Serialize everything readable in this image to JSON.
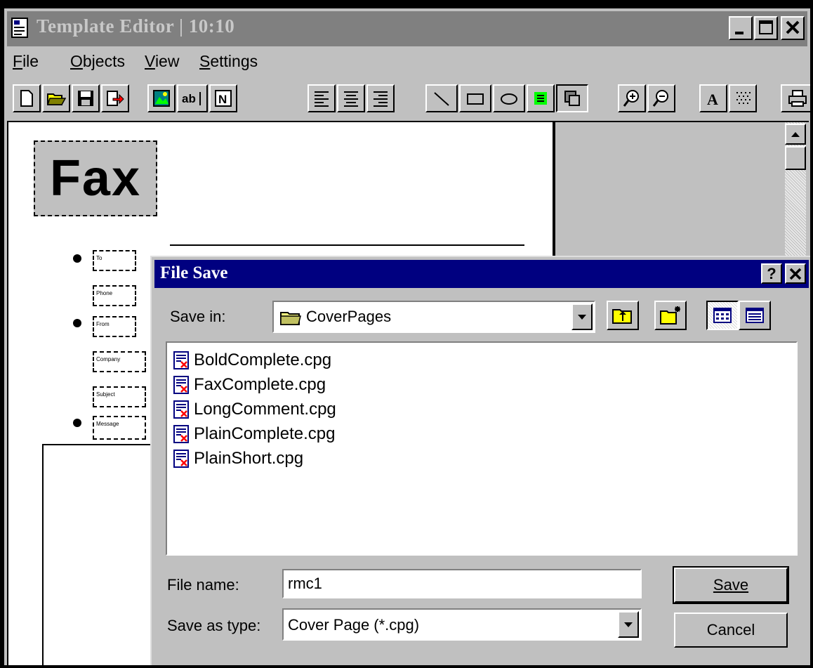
{
  "window": {
    "title": "Template Editor | 10:10",
    "controls": [
      "minimize-icon",
      "maximize-icon",
      "close-icon"
    ]
  },
  "menu": {
    "items": [
      "File",
      "Objects",
      "View",
      "Settings"
    ]
  },
  "toolbar": {
    "icons": [
      "new-document-icon",
      "open-folder-icon",
      "save-disk-icon",
      "export-icon",
      "image-icon",
      "text-field-icon",
      "field-n-icon",
      "align-left-icon",
      "align-center-icon",
      "align-right-icon",
      "line-icon",
      "rectangle-icon",
      "ellipse-icon",
      "fill-color-icon",
      "bring-to-front-icon",
      "zoom-in-icon",
      "zoom-out-icon",
      "font-icon",
      "grid-icon",
      "print-icon"
    ]
  },
  "page": {
    "logo_text": "Fax",
    "fields": [
      "To",
      "Phone",
      "From",
      "Company",
      "Subject",
      "Message"
    ]
  },
  "dialog": {
    "title": "File Save",
    "help_label": "?",
    "save_in_label": "Save in:",
    "save_in_value": "CoverPages",
    "files": [
      "BoldComplete.cpg",
      "FaxComplete.cpg",
      "LongComment.cpg",
      "PlainComplete.cpg",
      "PlainShort.cpg"
    ],
    "file_name_label": "File name:",
    "file_name_value": "rmc1",
    "save_as_type_label": "Save as type:",
    "save_as_type_value": "Cover Page  (*.cpg)",
    "save_button": "Save",
    "cancel_button": "Cancel"
  }
}
